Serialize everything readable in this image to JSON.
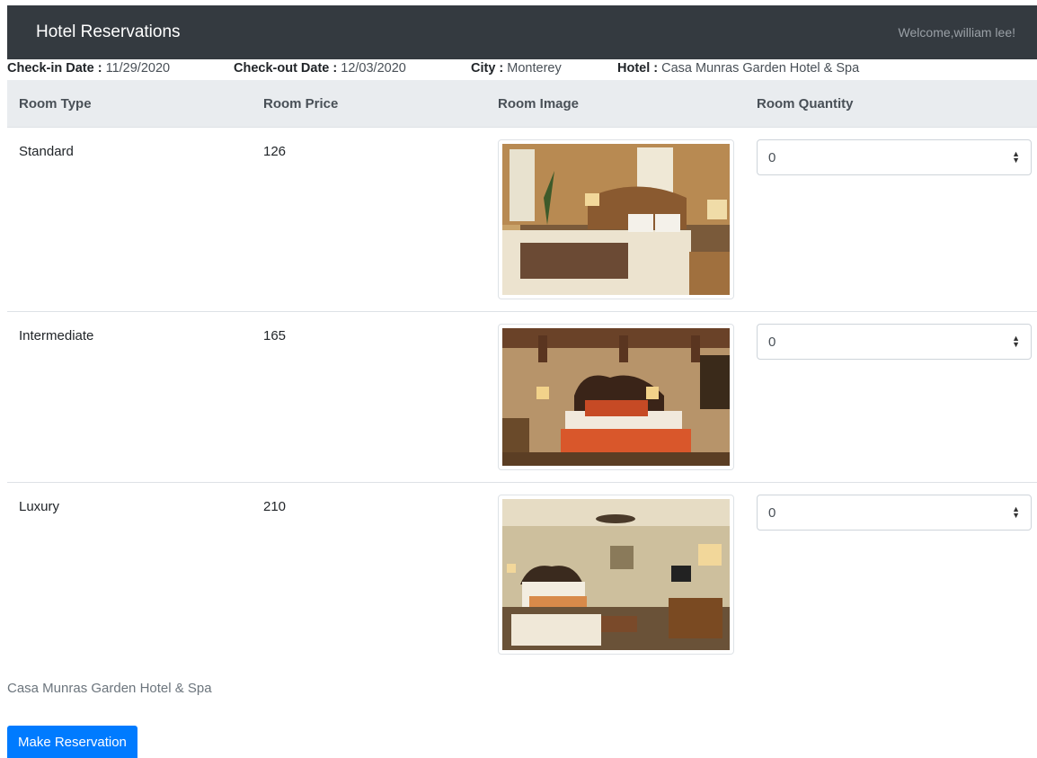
{
  "navbar": {
    "brand": "Hotel Reservations",
    "welcome": "Welcome,william lee!"
  },
  "info": {
    "checkin_label": "Check-in Date :",
    "checkin_value": "11/29/2020",
    "checkout_label": "Check-out Date :",
    "checkout_value": "12/03/2020",
    "city_label": "City :",
    "city_value": "Monterey",
    "hotel_label": "Hotel :",
    "hotel_value": "Casa Munras Garden Hotel & Spa"
  },
  "table": {
    "headers": [
      "Room Type",
      "Room Price",
      "Room Image",
      "Room Quantity"
    ],
    "rows": [
      {
        "type": "Standard",
        "price": "126",
        "quantity": "0",
        "image": "standard-room-photo"
      },
      {
        "type": "Intermediate",
        "price": "165",
        "quantity": "0",
        "image": "intermediate-room-photo"
      },
      {
        "type": "Luxury",
        "price": "210",
        "quantity": "0",
        "image": "luxury-room-photo"
      }
    ]
  },
  "footer": {
    "hotel_name": "Casa Munras Garden Hotel & Spa",
    "button_label": "Make Reservation"
  },
  "colors": {
    "navbar": "#343a40",
    "header_bg": "#e9ecef",
    "primary": "#007bff"
  },
  "icons": {
    "select_arrows": "sort-arrows-icon"
  }
}
